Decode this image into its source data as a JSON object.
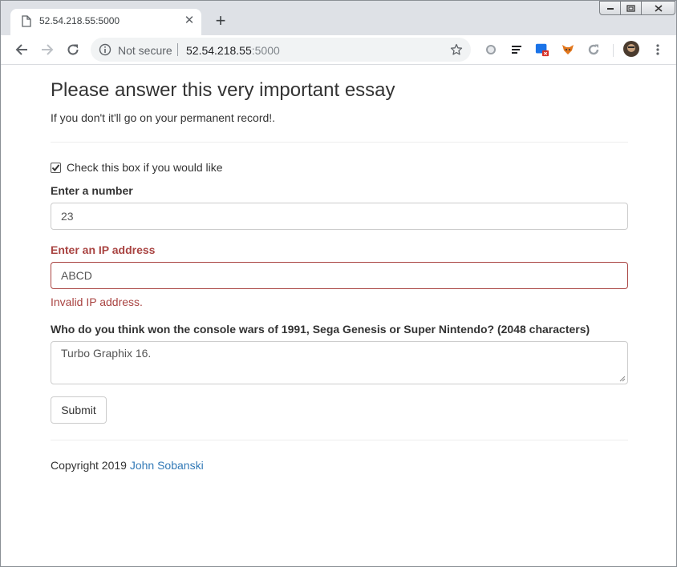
{
  "browser": {
    "tab_title": "52.54.218.55:5000",
    "security_label": "Not secure",
    "url_host": "52.54.218.55",
    "url_port": ":5000"
  },
  "page": {
    "heading": "Please answer this very important essay",
    "subtitle": "If you don't it'll go on your permanent record!.",
    "checkbox": {
      "label": "Check this box if you would like",
      "checked": true
    },
    "number_field": {
      "label": "Enter a number",
      "value": "23"
    },
    "ip_field": {
      "label": "Enter an IP address",
      "value": "ABCD",
      "error": "Invalid IP address."
    },
    "essay_field": {
      "label": "Who do you think won the console wars of 1991, Sega Genesis or Super Nintendo? (2048 characters)",
      "value": "Turbo Graphix 16."
    },
    "submit_label": "Submit",
    "footer": {
      "prefix": "Copyright 2019 ",
      "author": "John Sobanski"
    }
  },
  "colors": {
    "error": "#a94442",
    "link": "#337ab7",
    "text": "#333333"
  }
}
